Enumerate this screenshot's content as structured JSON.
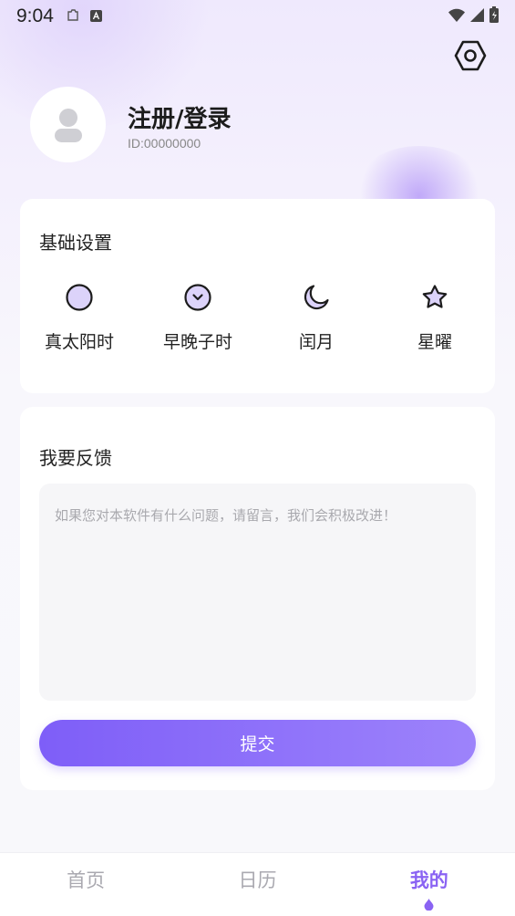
{
  "status_bar": {
    "time": "9:04",
    "icons": [
      "clipboard-icon",
      "a-badge-icon",
      "wifi-icon",
      "signal-icon",
      "battery-icon"
    ]
  },
  "header": {
    "settings_icon": "hexagon-gear-icon"
  },
  "profile": {
    "name": "注册/登录",
    "id_text": "ID:00000000",
    "avatar_icon": "person-icon"
  },
  "basic_settings": {
    "title": "基础设置",
    "items": [
      {
        "label": "真太阳时",
        "icon": "circle-icon"
      },
      {
        "label": "早晚子时",
        "icon": "clock-chevron-icon"
      },
      {
        "label": "闰月",
        "icon": "moon-icon"
      },
      {
        "label": "星曜",
        "icon": "star-icon"
      }
    ]
  },
  "feedback": {
    "title": "我要反馈",
    "placeholder": "如果您对本软件有什么问题，请留言，我们会积极改进！",
    "value": "",
    "submit_label": "提交"
  },
  "bottom_nav": {
    "items": [
      {
        "label": "首页",
        "active": false
      },
      {
        "label": "日历",
        "active": false
      },
      {
        "label": "我的",
        "active": true
      }
    ]
  },
  "colors": {
    "accent": "#8a63f3",
    "icon_fill": "#dcd3fa",
    "button_start": "#7e5ef8",
    "button_end": "#9d83fb"
  }
}
